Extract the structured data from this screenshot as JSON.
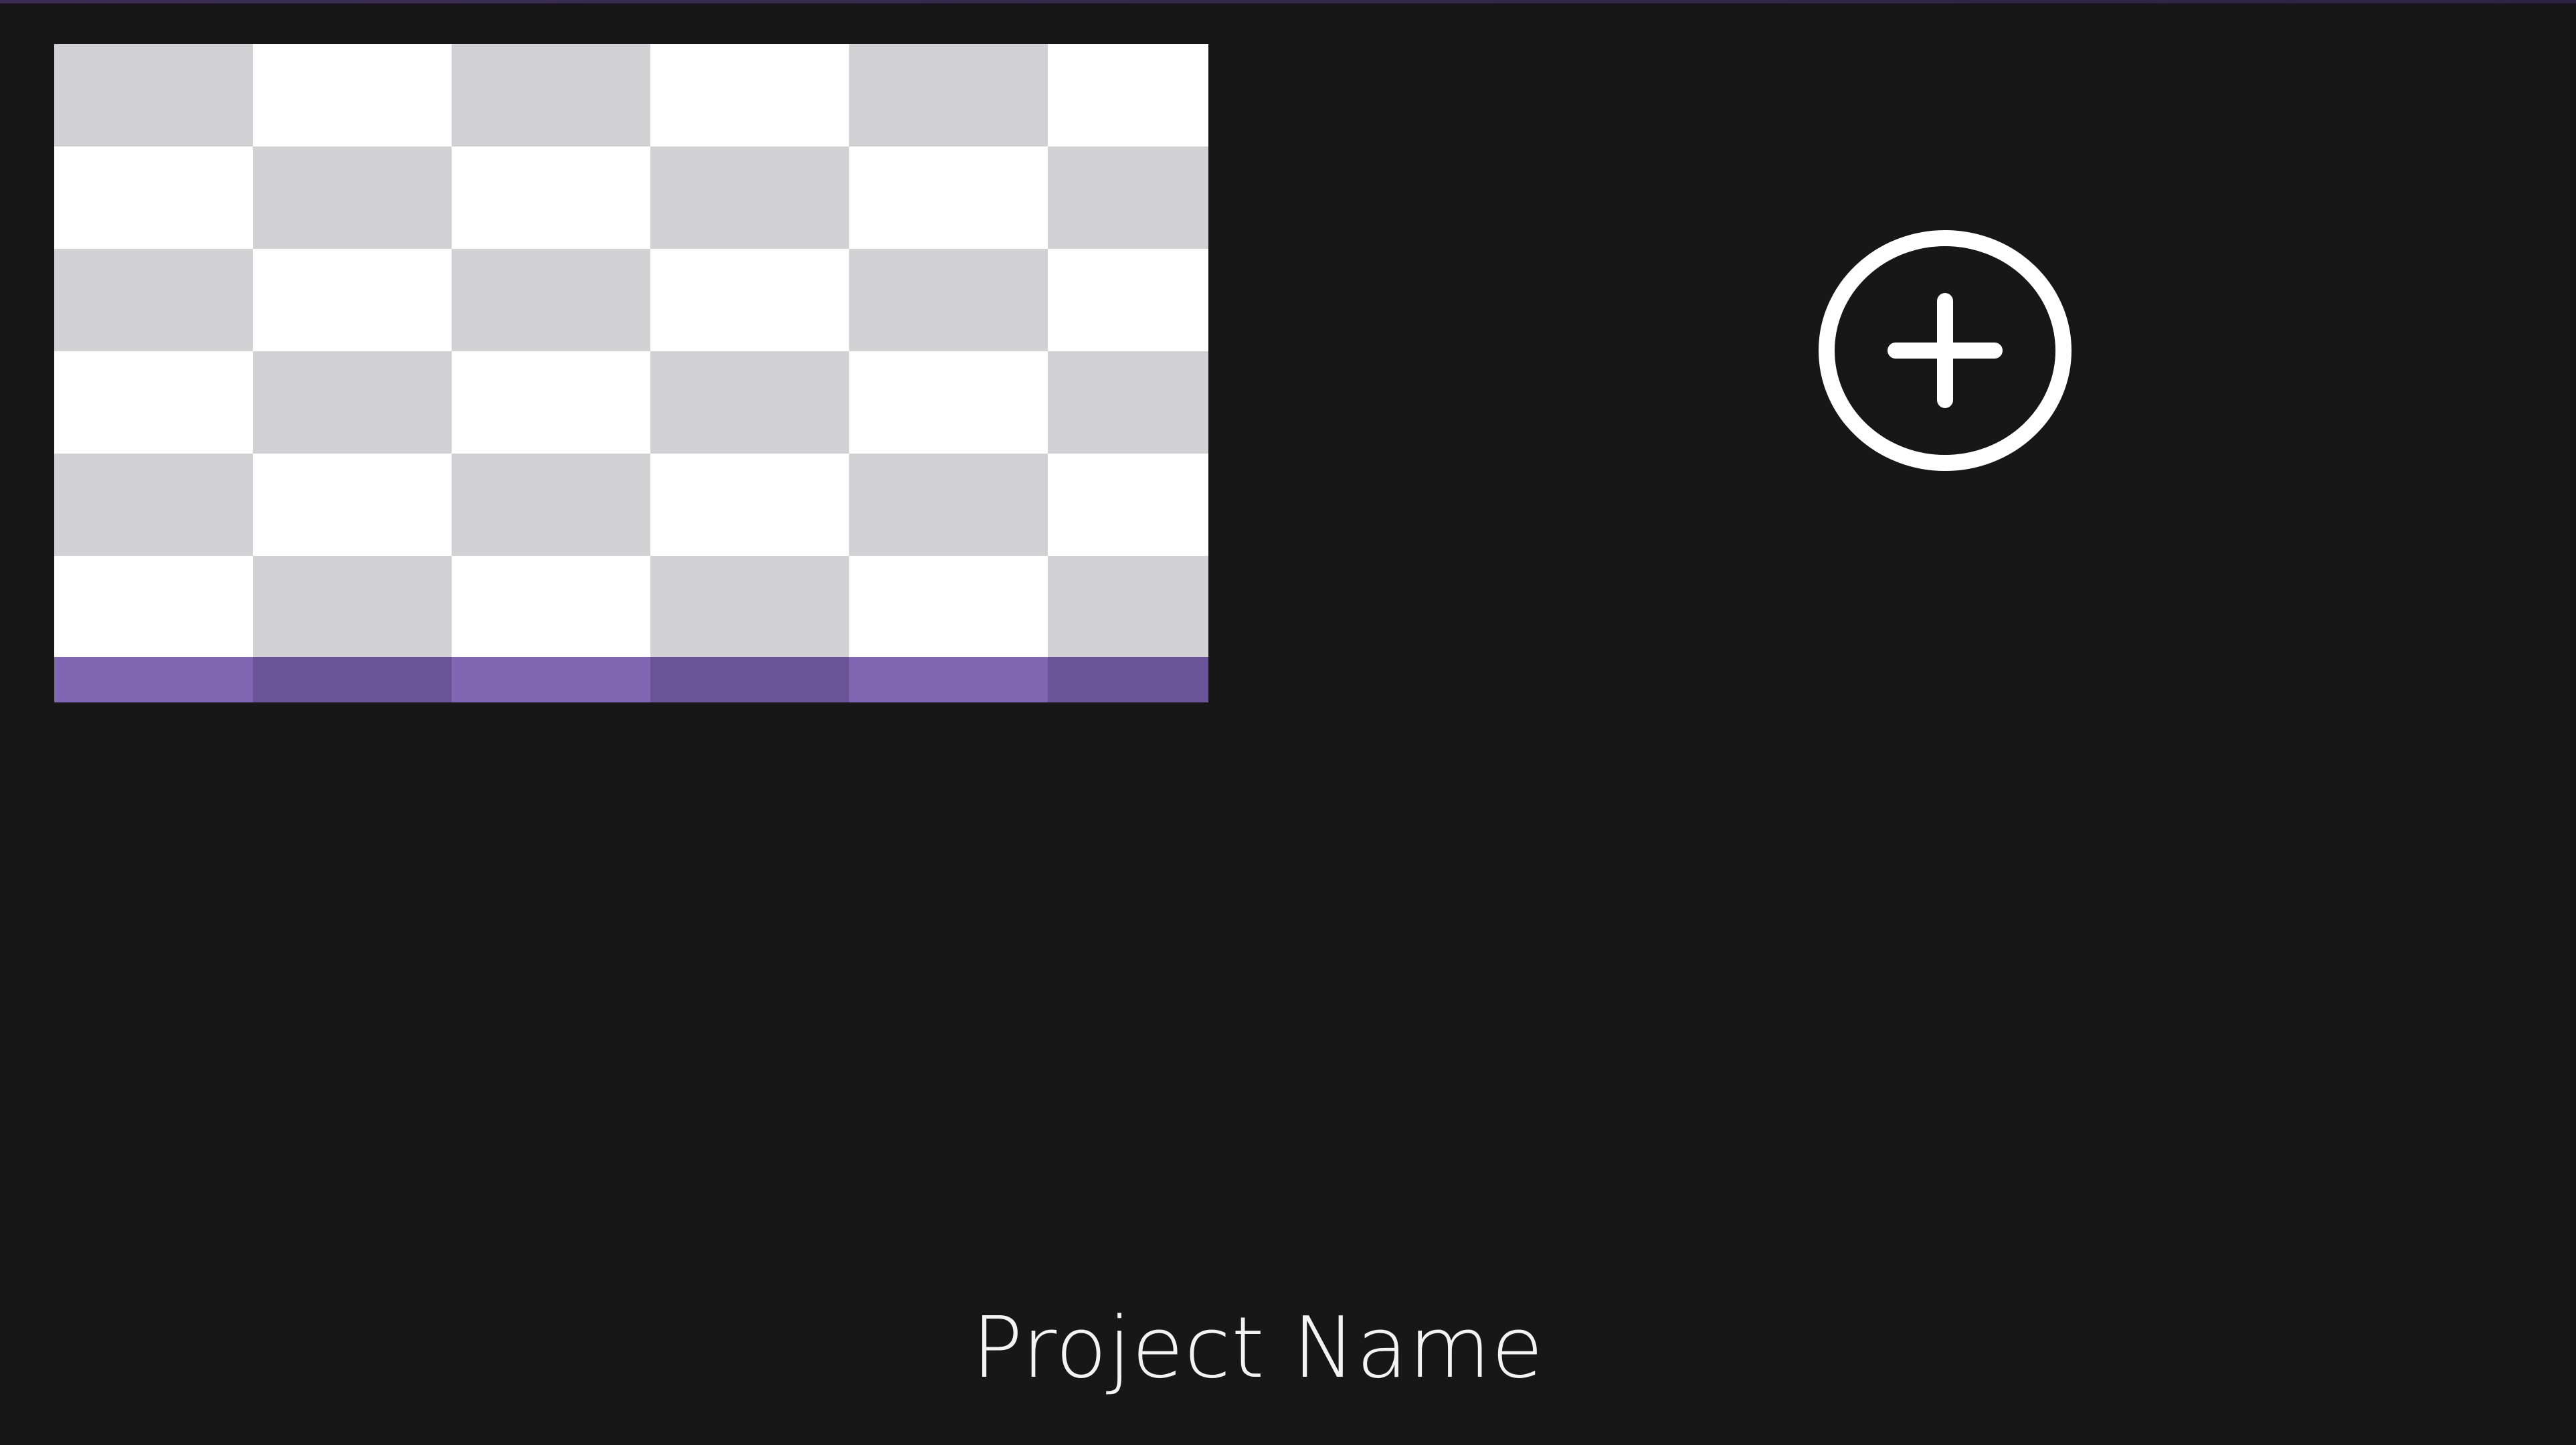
{
  "project": {
    "name": "Project Name"
  },
  "icons": {
    "add": "plus-circle-icon",
    "thumbnail": "transparent-checker-thumbnail"
  },
  "colors": {
    "background": "#171717",
    "accent": "#8166b3",
    "accent_dark": "#6a5396",
    "checker_gray": "#d2d2d4",
    "checker_white": "#ffffff",
    "text": "#f3f3f3"
  }
}
